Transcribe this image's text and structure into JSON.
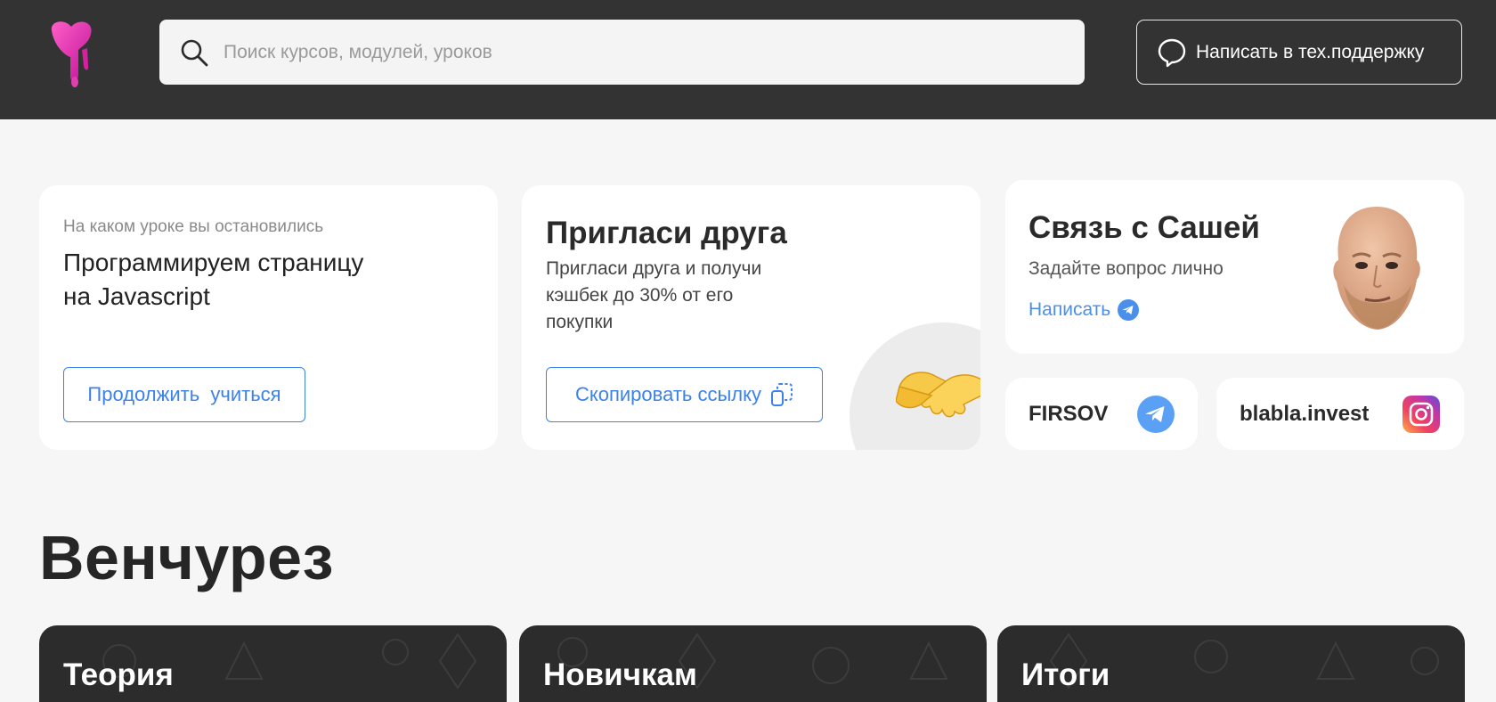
{
  "header": {
    "logo": "logo-icon",
    "search": {
      "placeholder": "Поиск курсов, модулей, уроков",
      "value": "",
      "icon": "search-icon"
    },
    "support": {
      "label": "Написать в тех.поддержку",
      "icon": "chat-bubble-icon"
    }
  },
  "resume_card": {
    "caption": "На каком уроке вы остановились",
    "lesson_line1": "Программируем страницу",
    "lesson_line2": "на Javascript",
    "button": "Продолжить  учиться"
  },
  "invite_card": {
    "title": "Пригласи друга",
    "description_line1": "Пригласи друга и получи",
    "description_line2": "кэшбек до 30% от его",
    "description_line3": "покупки",
    "button": "Скопировать ссылку",
    "button_icon": "copy-icon",
    "illustration": "handshake-icon"
  },
  "sasha_card": {
    "title": "Связь с Сашей",
    "subtitle": "Задайте вопрос лично",
    "link": "Написать",
    "link_icon": "telegram-icon",
    "photo": "avatar"
  },
  "socials": [
    {
      "name": "FIRSOV",
      "icon": "telegram-icon",
      "color": "#5aa1f5"
    },
    {
      "name": "blabla.invest",
      "icon": "instagram-icon"
    }
  ],
  "section": {
    "title": "Венчурез",
    "cards": [
      {
        "title": "Теория"
      },
      {
        "title": "Новичкам"
      },
      {
        "title": "Итоги"
      }
    ]
  },
  "colors": {
    "topbar": "#333333",
    "accent": "#3d82e8",
    "background": "#f6f6f6",
    "card_dark": "#2c2c2c"
  }
}
